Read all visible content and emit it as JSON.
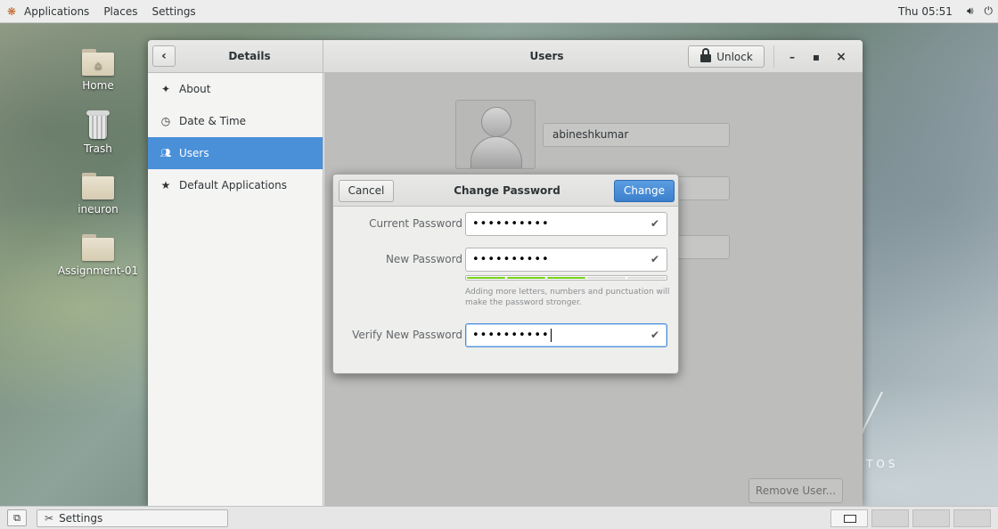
{
  "topbar": {
    "applications": "Applications",
    "places": "Places",
    "settings": "Settings",
    "clock": "Thu 05:51",
    "volume_icon": "volume-icon",
    "power_icon": "power-icon"
  },
  "desktop": {
    "icons": [
      {
        "label": "Home",
        "icon": "home-folder-icon"
      },
      {
        "label": "Trash",
        "icon": "trash-icon"
      },
      {
        "label": "ineuron",
        "icon": "folder-icon"
      },
      {
        "label": "Assignment-01",
        "icon": "folder-icon"
      }
    ],
    "wallpaper_text": "TOS"
  },
  "window": {
    "sidebar_title": "Details",
    "title": "Users",
    "unlock_label": "Unlock",
    "minimize": "–",
    "maximize": "▪",
    "close": "×",
    "sidebar": {
      "items": [
        {
          "label": "About",
          "icon": "star-icon"
        },
        {
          "label": "Date & Time",
          "icon": "clock-icon"
        },
        {
          "label": "Users",
          "icon": "users-icon",
          "active": true
        },
        {
          "label": "Default Applications",
          "icon": "star-icon"
        }
      ]
    },
    "user": {
      "name": "abineshkumar"
    },
    "remove_user_label": "Remove User..."
  },
  "dialog": {
    "title": "Change Password",
    "cancel_label": "Cancel",
    "change_label": "Change",
    "current_password_label": "Current Password",
    "current_password_value": "••••••••••",
    "new_password_label": "New Password",
    "new_password_value": "••••••••••",
    "strength_segments_filled": 3,
    "strength_segments_total": 5,
    "strength_hint": "Adding more letters, numbers and punctuation will make the password stronger.",
    "verify_password_label": "Verify New Password",
    "verify_password_value": "••••••••••",
    "check_mark": "✔",
    "accent_color": "#4a90d9"
  },
  "taskbar": {
    "task_label": "Settings",
    "workspaces": 4,
    "active_workspace": 1
  }
}
